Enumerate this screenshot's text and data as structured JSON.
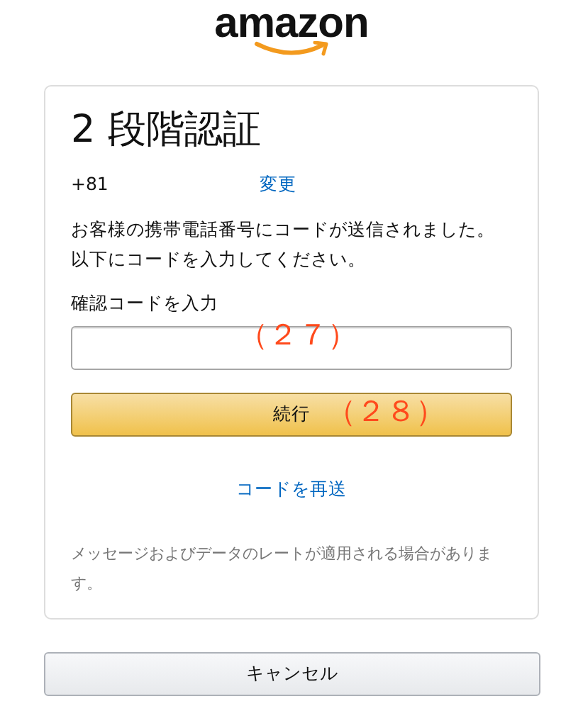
{
  "logo": {
    "text": "amazon"
  },
  "card": {
    "title": "2 段階認証",
    "phone": "+81",
    "change_link": "変更",
    "message": "お客様の携帯電話番号にコードが送信されました。以下にコードを入力してください。",
    "code_label": "確認コードを入力",
    "code_annotation": "（２７）",
    "continue_button": "続行",
    "continue_annotation": "（２８）",
    "resend_link": "コードを再送",
    "note": "メッセージおよびデータのレートが適用される場合があります。"
  },
  "cancel_button": "キャンセル"
}
